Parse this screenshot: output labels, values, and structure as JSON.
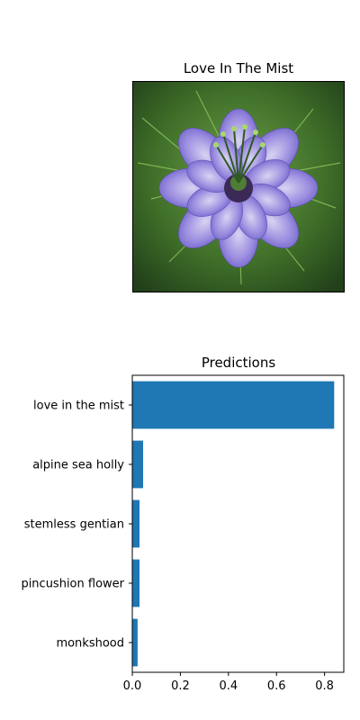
{
  "image_panel": {
    "title": "Love In The Mist"
  },
  "chart_data": {
    "type": "bar",
    "orientation": "horizontal",
    "title": "Predictions",
    "categories": [
      "love in the mist",
      "alpine sea holly",
      "stemless gentian",
      "pincushion flower",
      "monkshood"
    ],
    "values": [
      0.84,
      0.045,
      0.03,
      0.03,
      0.022
    ],
    "xlim": [
      0,
      0.88
    ],
    "xticks": [
      0.0,
      0.2,
      0.4,
      0.6,
      0.8
    ],
    "xtick_labels": [
      "0.0",
      "0.2",
      "0.4",
      "0.6",
      "0.8"
    ],
    "xlabel": "",
    "ylabel": "",
    "bar_color": "#1f77b4",
    "grid": false
  }
}
